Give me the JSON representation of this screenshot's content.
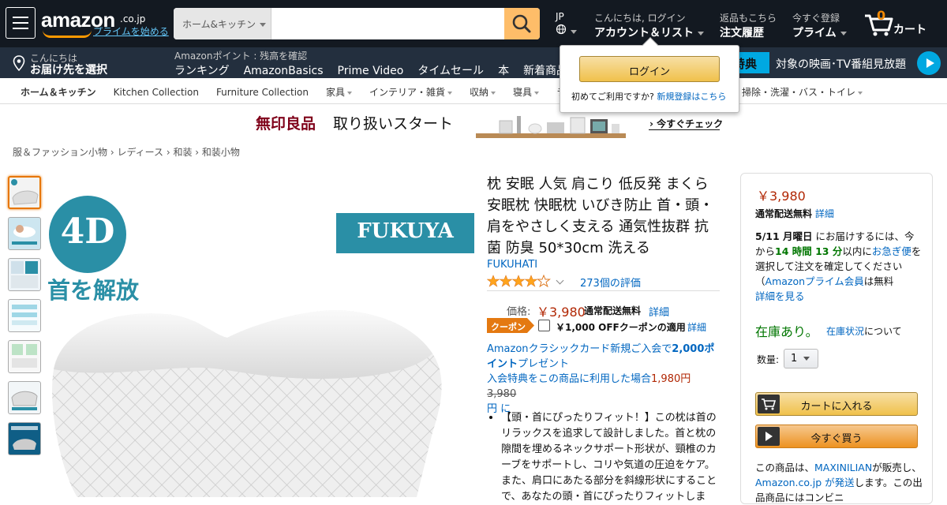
{
  "nav": {
    "logo": "amazon",
    "logo_suffix": ".co.jp",
    "prime_link": "プライムを始める",
    "search_category": "ホーム&キッチン",
    "search_value": "",
    "lang": "JP",
    "account_greeting": "こんにちは, ログイン",
    "account_label": "アカウント＆リスト",
    "returns_small": "返品もこちら",
    "returns_label": "注文履歴",
    "prime_small": "今すぐ登録",
    "prime_label": "プライム",
    "cart_count": "0",
    "cart_label": "カート"
  },
  "subnav": {
    "deliver_small": "こんにちは",
    "deliver_label": "お届け先を選択",
    "points": "Amazonポイント : 残高を確認",
    "links": [
      "ランキング",
      "AmazonBasics",
      "Prime Video",
      "タイムセール",
      "本",
      "新着商品"
    ],
    "promo_badge": "特典",
    "promo_text": "対象の映画･TV番組見放題"
  },
  "catnav": {
    "items": [
      "ホーム＆キッチン",
      "Kitchen Collection",
      "Furniture Collection",
      "家具",
      "インテリア・雑貨",
      "収納",
      "寝具",
      "ラグ"
    ],
    "right_item": "掃除・洗濯・バス・トイレ"
  },
  "popup": {
    "login_button": "ログイン",
    "first_time": "初めてご利用ですか?",
    "signup_link": "新規登録はこちら"
  },
  "banner": {
    "brand": "無印良品",
    "text": "取り扱いスタート",
    "cta": "今すぐチェック"
  },
  "breadcrumb": [
    "服＆ファッション小物",
    "レディース",
    "和装",
    "和装小物"
  ],
  "image": {
    "badge_4d": "4D",
    "caption": "首を解放",
    "brand_badge": "FUKUYA"
  },
  "product": {
    "title": "枕 安眠 人気 肩こり 低反発 まくら 安眠枕 快眠枕 いびき防止 首・頭・肩をやさしく支える 通気性抜群 抗菌 防臭 50*30cm 洗える",
    "brand": "FUKUHATI",
    "rating": 4,
    "reviews": "273個の評価",
    "price_label": "価格:",
    "price": "￥3,980",
    "shipping": "通常配送無料",
    "detail": "詳細",
    "coupon_badge": "クーポン",
    "coupon_text": "￥1,000 OFFクーポンの適用",
    "card_text1": "Amazonクラシックカード新規ご入会で",
    "card_points": "2,000ポイント",
    "card_text2": "プレゼント",
    "card_text3": "入会特典をこの商品に利用した場合",
    "card_price": "1,980円",
    "card_old": "3,980",
    "card_text4": "円 に",
    "bullet": "【頭・首にぴったりフィット！】この枕は首のリラックスを追求して設計しました。首と枕の隙間を埋めるネックサポート形状が、頸椎のカーブをサポートし、コリや気道の圧迫をケア。また、肩口にあたる部分を斜線形状にすることで、あなたの頭・首にぴったりフィットしま"
  },
  "buybox": {
    "price": "￥3,980",
    "shipping": "通常配送無料",
    "detail": "詳細",
    "delivery_date": "5/11 月曜日",
    "delivery_text1": "にお届けするには、今から",
    "delivery_time": "14 時間 13 分",
    "delivery_text2": "以内に",
    "rush": "お急ぎ便",
    "delivery_text3": "を選択して注文を確定してください（",
    "prime_member": "Amazonプライム会員",
    "delivery_text4": "は無料",
    "see_more": "詳細を見る",
    "stock": "在庫あり。",
    "stock_link": "在庫状況",
    "stock_about": "について",
    "qty_label": "数量:",
    "qty_value": "1",
    "add_cart": "カートに入れる",
    "buy_now": "今すぐ買う",
    "seller_text1": "この商品は、",
    "seller": "MAXINILIAN",
    "seller_text2": "が販売し、",
    "shipper": "Amazon.co.jp が発送",
    "seller_text3": "します。",
    "seller_text4": "この出品商品にはコンビニ"
  }
}
